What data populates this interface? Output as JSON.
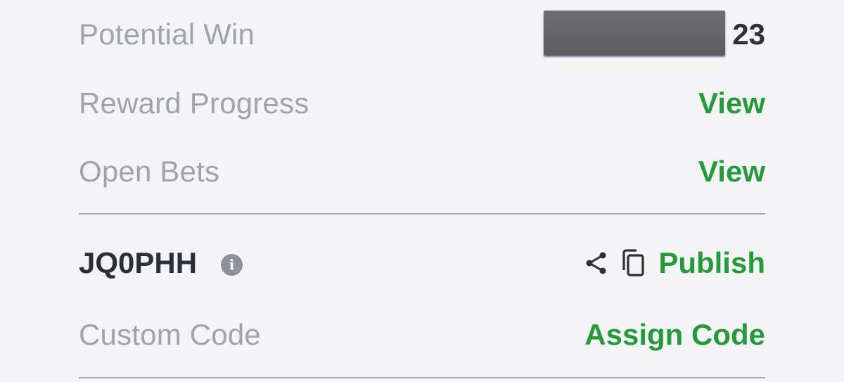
{
  "potential_win": {
    "label": "Potential Win",
    "value_visible": "23"
  },
  "reward_progress": {
    "label": "Reward Progress",
    "action": "View"
  },
  "open_bets": {
    "label": "Open Bets",
    "action": "View"
  },
  "bet_code": {
    "code": "JQ0PHH",
    "info_icon": "info-icon",
    "share_icon": "share-icon",
    "copy_icon": "copy-icon",
    "publish_label": "Publish"
  },
  "custom_code": {
    "label": "Custom Code",
    "action": "Assign Code"
  },
  "colors": {
    "label_gray": "#9ea3ad",
    "accent_green": "#249a3b",
    "dark_text": "#2b2f38",
    "background": "#f4f4f6"
  }
}
